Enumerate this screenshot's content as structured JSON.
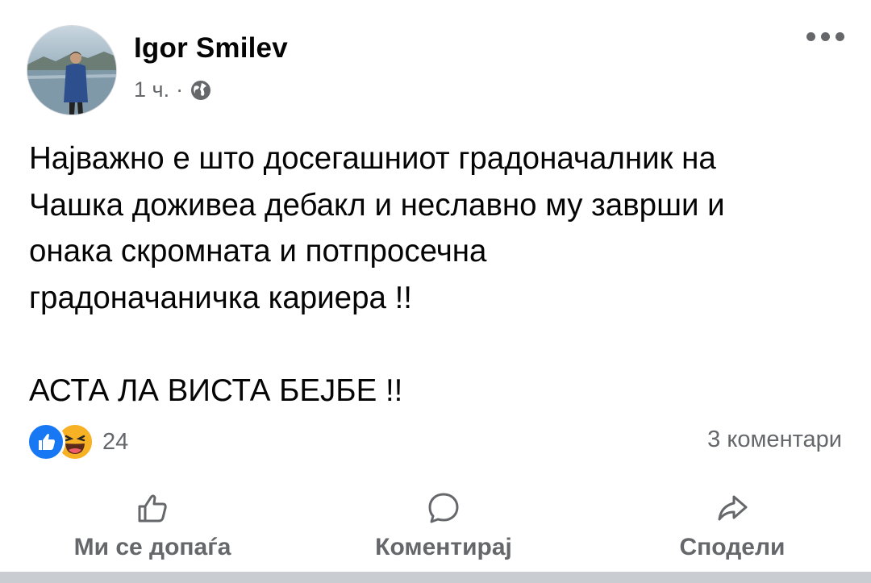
{
  "post": {
    "author": "Igor Smilev",
    "time": "1 ч.",
    "separator": "·",
    "audience_icon": "globe-icon",
    "text_lines": [
      "Најважно е што досегашниот градоначалник на",
      "Чашка доживеа дебакл и неславно му заврши и",
      "онака скромната и потпросечна",
      "градоначаничка кариера !!"
    ],
    "text_line_last": "АСТА ЛА ВИСТА БЕЈБЕ !!"
  },
  "reactions": {
    "types": [
      "like-reaction-icon",
      "haha-reaction-icon"
    ],
    "count": "24"
  },
  "comments": {
    "count_label": "3 коментари"
  },
  "actions": {
    "like_label": "Ми се допаѓа",
    "comment_label": "Коментирај",
    "share_label": "Сподели"
  },
  "colors": {
    "secondary_text": "#65676b",
    "like_blue": "#1877f2",
    "haha_yellow": "#f7b125"
  }
}
